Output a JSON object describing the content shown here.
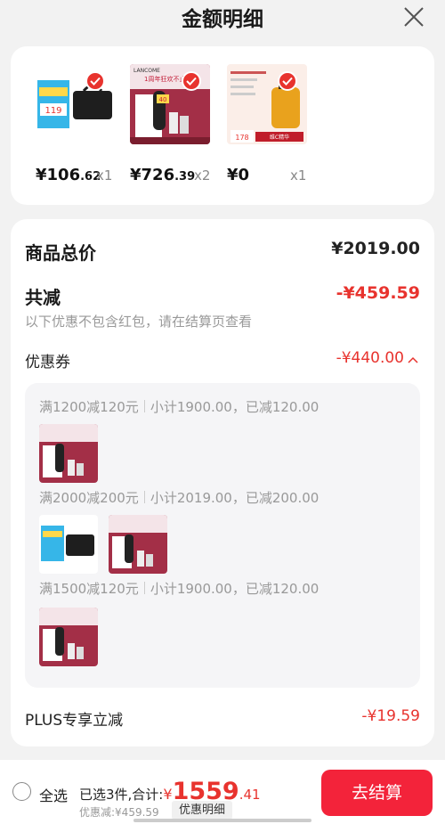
{
  "header": {
    "title": "金额明细"
  },
  "products": [
    {
      "price_int": "¥106",
      "price_dec": ".62",
      "qty": "x1"
    },
    {
      "price_int": "¥726",
      "price_dec": ".39",
      "qty": "x2"
    },
    {
      "price_int": "¥0",
      "price_dec": "",
      "qty": "x1"
    }
  ],
  "summary": {
    "total_label": "商品总价",
    "total_value": "¥2019.00",
    "reduce_label": "共减",
    "reduce_value": "-¥459.59",
    "note": "以下优惠不包含红包，请在结算页查看",
    "coupon_label": "优惠券",
    "coupon_value": "-¥440.00",
    "plus_label": "PLUS专享立减",
    "plus_value": "-¥19.59"
  },
  "coupons": [
    {
      "rule": "满1200减120元",
      "detail": "小计1900.00，已减120.00"
    },
    {
      "rule": "满2000减200元",
      "detail": "小计2019.00，已减200.00"
    },
    {
      "rule": "满1500减120元",
      "detail": "小计1900.00，已减120.00"
    }
  ],
  "product_labels": {
    "p1_badge": "119",
    "p2_brand": "LANCOME",
    "p2_headline": "1周年狂欢不止1折",
    "p2_badge": "40",
    "p3_badge": "178",
    "p3_tag": "维C精华"
  },
  "footer": {
    "select_all": "全选",
    "selected_text": "已选3件,合计:",
    "total_sym": "¥",
    "total_int": "1559",
    "total_dec": ".41",
    "discount": "优惠减:¥459.59",
    "detail_button": "优惠明细",
    "checkout_button": "去结算"
  },
  "colors": {
    "accent": "#e8332e",
    "checkout": "#f3233a"
  }
}
